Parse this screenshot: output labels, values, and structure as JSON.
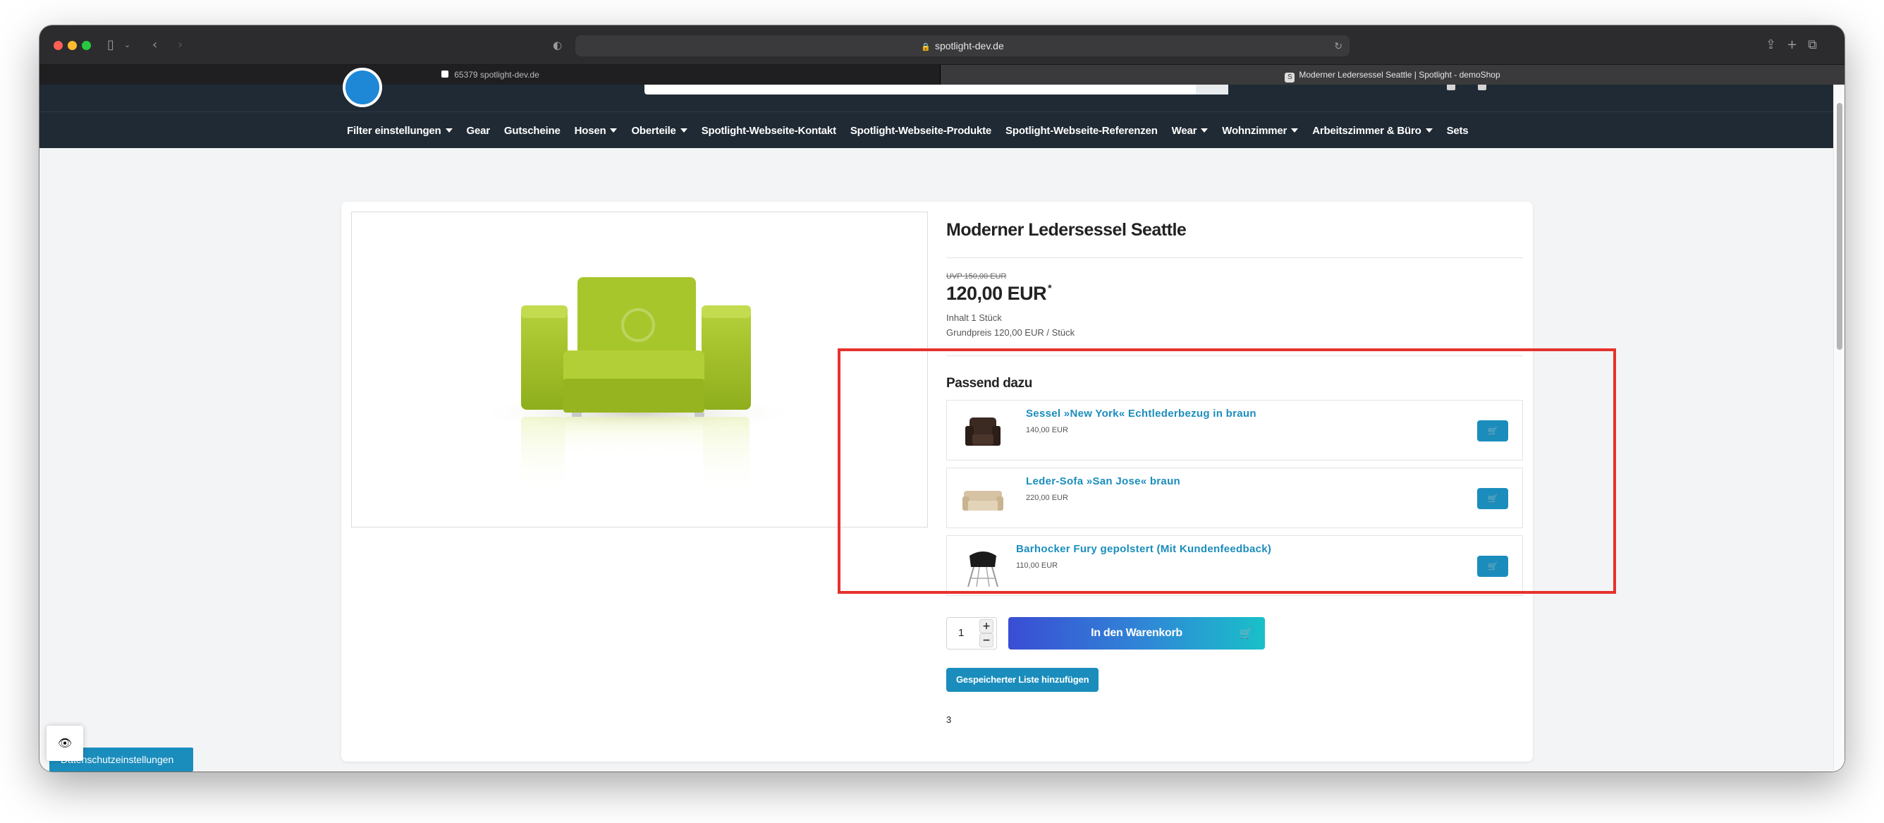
{
  "browser": {
    "address": "spotlight-dev.de",
    "tabs": [
      {
        "label": "65379 spotlight-dev.de"
      },
      {
        "label": "Moderner Ledersessel Seattle | Spotlight - demoShop"
      }
    ]
  },
  "nav": {
    "items": [
      {
        "label": "Filter einstellungen",
        "dropdown": true
      },
      {
        "label": "Gear",
        "dropdown": false
      },
      {
        "label": "Gutscheine",
        "dropdown": false
      },
      {
        "label": "Hosen",
        "dropdown": true
      },
      {
        "label": "Oberteile",
        "dropdown": true
      },
      {
        "label": "Spotlight-Webseite-Kontakt",
        "dropdown": false
      },
      {
        "label": "Spotlight-Webseite-Produkte",
        "dropdown": false
      },
      {
        "label": "Spotlight-Webseite-Referenzen",
        "dropdown": false
      },
      {
        "label": "Wear",
        "dropdown": true
      },
      {
        "label": "Wohnzimmer",
        "dropdown": true
      },
      {
        "label": "Arbeitszimmer & Büro",
        "dropdown": true
      },
      {
        "label": "Sets",
        "dropdown": false
      }
    ]
  },
  "product": {
    "title": "Moderner Ledersessel Seattle",
    "uvp": "UVP 150,00 EUR",
    "price": "120,00 EUR",
    "price_marker": "*",
    "content": "Inhalt 1 Stück",
    "base_price": "Grundpreis 120,00 EUR / Stück",
    "quantity": "1",
    "add_to_cart": "In den Warenkorb",
    "wishlist": "Gespeicherter Liste hinzufügen",
    "footnote": "3"
  },
  "recommendations": {
    "title": "Passend dazu",
    "items": [
      {
        "name": "Sessel »New York« Echtlederbezug in braun",
        "price": "140,00 EUR"
      },
      {
        "name": "Leder-Sofa »San Jose« braun",
        "price": "220,00 EUR"
      },
      {
        "name": "Barhocker Fury gepolstert (Mit Kundenfeedback)",
        "price": "110,00 EUR"
      }
    ]
  },
  "cookie": {
    "label": "Datenschutzeinstellungen"
  },
  "colors": {
    "accent": "#1a8dbd",
    "nav_bg": "#202a34",
    "highlight": "#e5322d"
  }
}
